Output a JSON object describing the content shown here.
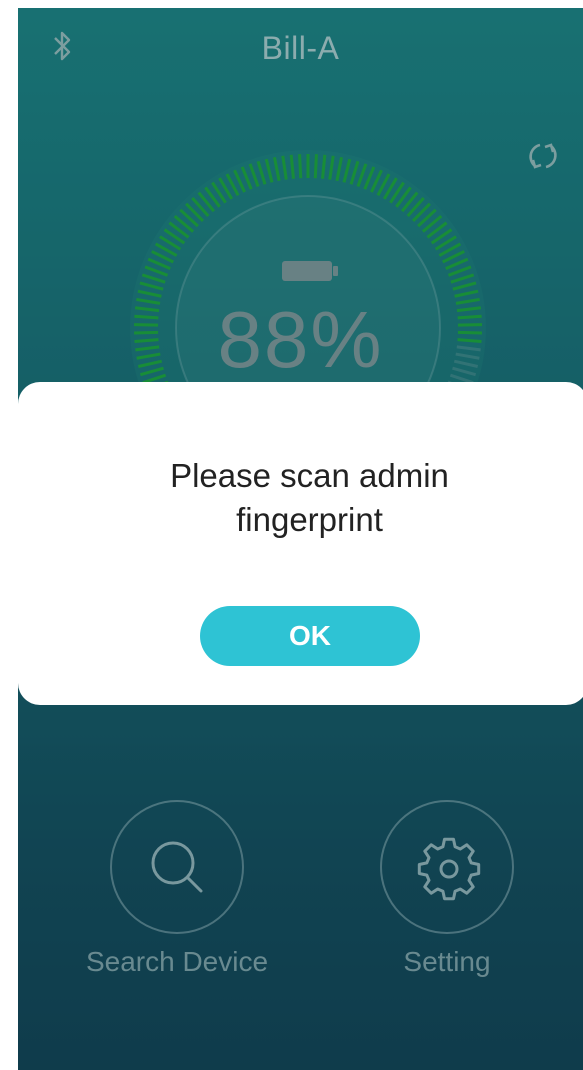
{
  "header": {
    "title": "Bill-A",
    "bluetooth_icon": "bluetooth-icon",
    "refresh_icon": "refresh-icon"
  },
  "battery": {
    "percent_text": "88%",
    "level": 0.88,
    "icon": "battery-icon"
  },
  "actions": [
    {
      "label": "Search Device",
      "icon": "magnifier-icon"
    },
    {
      "label": "Setting",
      "icon": "gear-icon"
    }
  ],
  "dialog": {
    "message_line1": "Please scan admin",
    "message_line2": "fingerprint",
    "ok_label": "OK"
  },
  "colors": {
    "background_top": "#1f8d8c",
    "background_bottom": "#134457",
    "gauge_tick": "#1fb53b",
    "accent_button": "#2ec3d4"
  }
}
